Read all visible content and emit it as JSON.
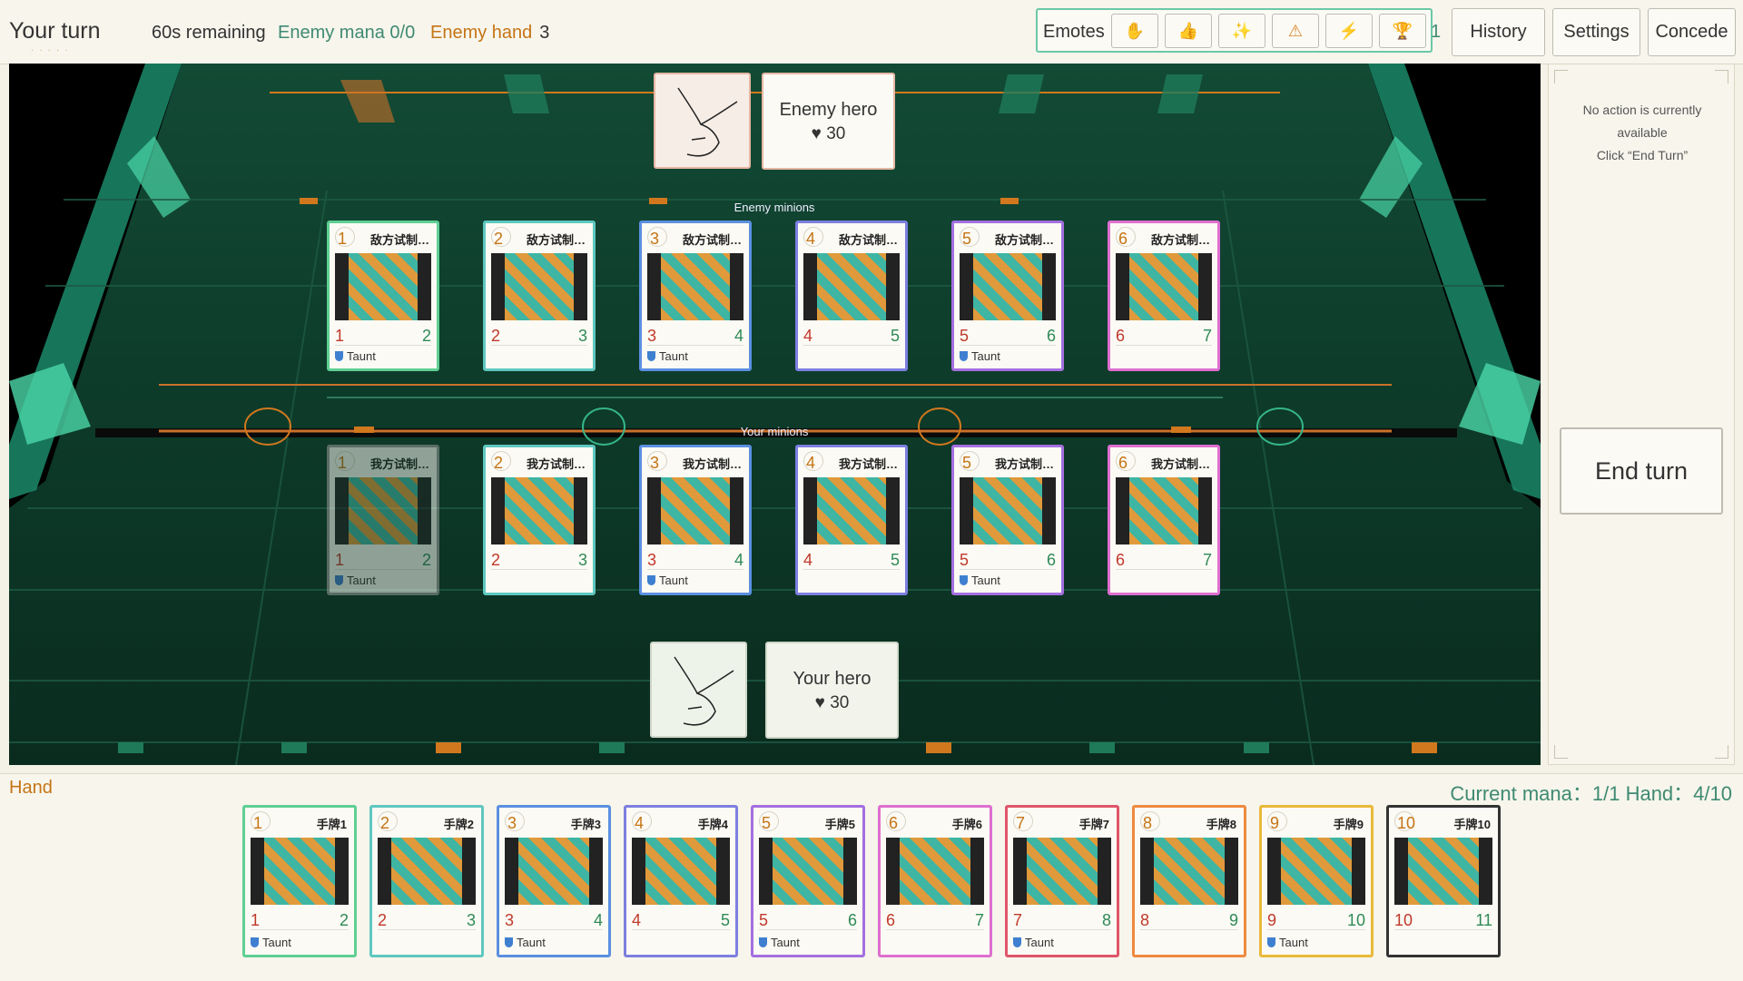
{
  "topbar": {
    "turn_label": "Your turn",
    "timer": "60s remaining",
    "enemy_mana": "Enemy mana 0/0",
    "enemy_hand_label": "Enemy hand",
    "enemy_hand_count": "3",
    "emotes_label": "Emotes",
    "emotes": [
      {
        "name": "wave-emote-icon",
        "glyph": "✋"
      },
      {
        "name": "thumbs-up-emote-icon",
        "glyph": "👍"
      },
      {
        "name": "sparkle-emote-icon",
        "glyph": "✨"
      },
      {
        "name": "warning-emote-icon",
        "glyph": "⚠"
      },
      {
        "name": "lightning-emote-icon",
        "glyph": "⚡"
      },
      {
        "name": "trophy-emote-icon",
        "glyph": "🏆"
      }
    ],
    "emote_overflow": "1",
    "history": "History",
    "settings": "Settings",
    "concede": "Concede"
  },
  "board": {
    "enemy_hero": {
      "name": "Enemy hero",
      "hp": "♥ 30"
    },
    "your_hero": {
      "name": "Your hero",
      "hp": "♥ 30"
    },
    "enemy_minions_label": "Enemy minions",
    "your_minions_label": "Your minions",
    "enemy_minions": [
      {
        "cost": "1",
        "name": "敌方试制…",
        "atk": "1",
        "hp": "2",
        "taunt": "Taunt",
        "border": "#5fcf93"
      },
      {
        "cost": "2",
        "name": "敌方试制…",
        "atk": "2",
        "hp": "3",
        "taunt": "",
        "border": "#5ec8c0"
      },
      {
        "cost": "3",
        "name": "敌方试制…",
        "atk": "3",
        "hp": "4",
        "taunt": "Taunt",
        "border": "#5b8fe0"
      },
      {
        "cost": "4",
        "name": "敌方试制…",
        "atk": "4",
        "hp": "5",
        "taunt": "",
        "border": "#7d7fe0"
      },
      {
        "cost": "5",
        "name": "敌方试制…",
        "atk": "5",
        "hp": "6",
        "taunt": "Taunt",
        "border": "#a46fe0"
      },
      {
        "cost": "6",
        "name": "敌方试制…",
        "atk": "6",
        "hp": "7",
        "taunt": "",
        "border": "#de6fd0"
      }
    ],
    "your_minions": [
      {
        "cost": "1",
        "name": "我方试制…",
        "atk": "1",
        "hp": "2",
        "taunt": "Taunt",
        "border": "#9a9a9a",
        "dim": true
      },
      {
        "cost": "2",
        "name": "我方试制…",
        "atk": "2",
        "hp": "3",
        "taunt": "",
        "border": "#5ec8c0"
      },
      {
        "cost": "3",
        "name": "我方试制…",
        "atk": "3",
        "hp": "4",
        "taunt": "Taunt",
        "border": "#5b8fe0"
      },
      {
        "cost": "4",
        "name": "我方试制…",
        "atk": "4",
        "hp": "5",
        "taunt": "",
        "border": "#7d7fe0"
      },
      {
        "cost": "5",
        "name": "我方试制…",
        "atk": "5",
        "hp": "6",
        "taunt": "Taunt",
        "border": "#a46fe0"
      },
      {
        "cost": "6",
        "name": "我方试制…",
        "atk": "6",
        "hp": "7",
        "taunt": "",
        "border": "#de6fd0"
      }
    ]
  },
  "side": {
    "message_line1": "No action is currently",
    "message_line2": "available",
    "message_line3": "Click “End Turn”",
    "end_turn": "End turn"
  },
  "hand": {
    "label": "Hand",
    "stats": "Current mana：1/1    Hand：4/10",
    "cards": [
      {
        "cost": "1",
        "name": "手牌1",
        "atk": "1",
        "hp": "2",
        "taunt": "Taunt",
        "border": "#5fcf93"
      },
      {
        "cost": "2",
        "name": "手牌2",
        "atk": "2",
        "hp": "3",
        "taunt": "",
        "border": "#5ec8c0"
      },
      {
        "cost": "3",
        "name": "手牌3",
        "atk": "3",
        "hp": "4",
        "taunt": "Taunt",
        "border": "#5b8fe0"
      },
      {
        "cost": "4",
        "name": "手牌4",
        "atk": "4",
        "hp": "5",
        "taunt": "",
        "border": "#7d7fe0"
      },
      {
        "cost": "5",
        "name": "手牌5",
        "atk": "5",
        "hp": "6",
        "taunt": "Taunt",
        "border": "#a46fe0"
      },
      {
        "cost": "6",
        "name": "手牌6",
        "atk": "6",
        "hp": "7",
        "taunt": "",
        "border": "#de6fd0"
      },
      {
        "cost": "7",
        "name": "手牌7",
        "atk": "7",
        "hp": "8",
        "taunt": "Taunt",
        "border": "#e0566a"
      },
      {
        "cost": "8",
        "name": "手牌8",
        "atk": "8",
        "hp": "9",
        "taunt": "",
        "border": "#ee8a3f"
      },
      {
        "cost": "9",
        "name": "手牌9",
        "atk": "9",
        "hp": "10",
        "taunt": "Taunt",
        "border": "#e9b93a"
      },
      {
        "cost": "10",
        "name": "手牌10",
        "atk": "10",
        "hp": "11",
        "taunt": "",
        "border": "#333333"
      }
    ]
  }
}
